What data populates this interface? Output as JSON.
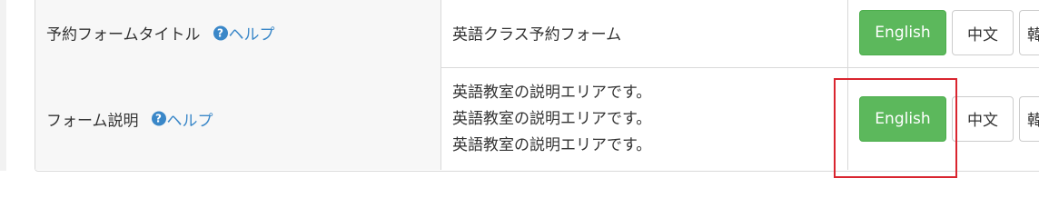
{
  "rows": [
    {
      "label": "予約フォームタイトル",
      "help_label": "ヘルプ",
      "help_icon": "question-circle-icon",
      "value": "英語クラス予約フォーム",
      "buttons": {
        "english": "English",
        "chinese": "中文",
        "partial": "韓"
      }
    },
    {
      "label": "フォーム説明",
      "help_label": "ヘルプ",
      "help_icon": "question-circle-icon",
      "value_lines": [
        "英語教室の説明エリアです。",
        "英語教室の説明エリアです。",
        "英語教室の説明エリアです。"
      ],
      "buttons": {
        "english": "English",
        "chinese": "中文",
        "partial": "韓"
      }
    }
  ],
  "colors": {
    "green_button": "#5cb85c",
    "help_link": "#3a87c8",
    "highlight": "#d9252f"
  }
}
